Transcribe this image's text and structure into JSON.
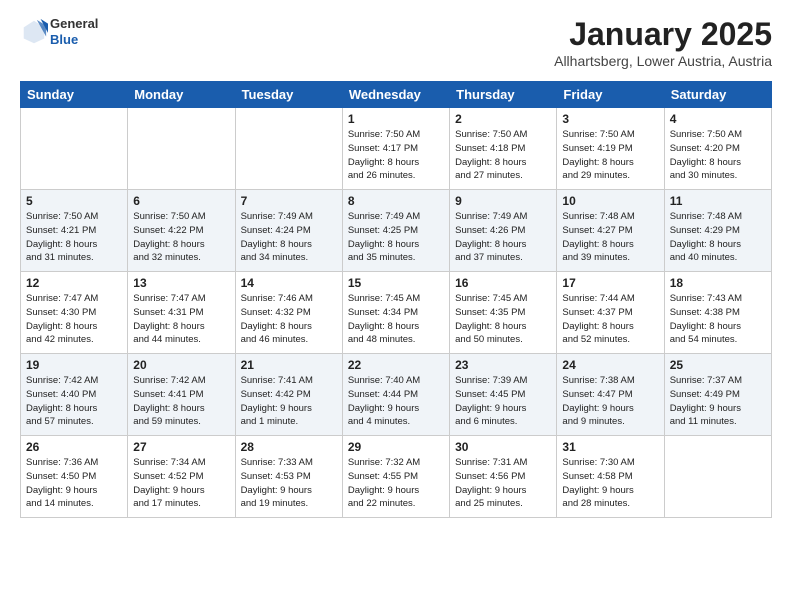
{
  "logo": {
    "general": "General",
    "blue": "Blue"
  },
  "header": {
    "title": "January 2025",
    "subtitle": "Allhartsberg, Lower Austria, Austria"
  },
  "weekdays": [
    "Sunday",
    "Monday",
    "Tuesday",
    "Wednesday",
    "Thursday",
    "Friday",
    "Saturday"
  ],
  "weeks": [
    [
      {
        "day": "",
        "info": ""
      },
      {
        "day": "",
        "info": ""
      },
      {
        "day": "",
        "info": ""
      },
      {
        "day": "1",
        "info": "Sunrise: 7:50 AM\nSunset: 4:17 PM\nDaylight: 8 hours\nand 26 minutes."
      },
      {
        "day": "2",
        "info": "Sunrise: 7:50 AM\nSunset: 4:18 PM\nDaylight: 8 hours\nand 27 minutes."
      },
      {
        "day": "3",
        "info": "Sunrise: 7:50 AM\nSunset: 4:19 PM\nDaylight: 8 hours\nand 29 minutes."
      },
      {
        "day": "4",
        "info": "Sunrise: 7:50 AM\nSunset: 4:20 PM\nDaylight: 8 hours\nand 30 minutes."
      }
    ],
    [
      {
        "day": "5",
        "info": "Sunrise: 7:50 AM\nSunset: 4:21 PM\nDaylight: 8 hours\nand 31 minutes."
      },
      {
        "day": "6",
        "info": "Sunrise: 7:50 AM\nSunset: 4:22 PM\nDaylight: 8 hours\nand 32 minutes."
      },
      {
        "day": "7",
        "info": "Sunrise: 7:49 AM\nSunset: 4:24 PM\nDaylight: 8 hours\nand 34 minutes."
      },
      {
        "day": "8",
        "info": "Sunrise: 7:49 AM\nSunset: 4:25 PM\nDaylight: 8 hours\nand 35 minutes."
      },
      {
        "day": "9",
        "info": "Sunrise: 7:49 AM\nSunset: 4:26 PM\nDaylight: 8 hours\nand 37 minutes."
      },
      {
        "day": "10",
        "info": "Sunrise: 7:48 AM\nSunset: 4:27 PM\nDaylight: 8 hours\nand 39 minutes."
      },
      {
        "day": "11",
        "info": "Sunrise: 7:48 AM\nSunset: 4:29 PM\nDaylight: 8 hours\nand 40 minutes."
      }
    ],
    [
      {
        "day": "12",
        "info": "Sunrise: 7:47 AM\nSunset: 4:30 PM\nDaylight: 8 hours\nand 42 minutes."
      },
      {
        "day": "13",
        "info": "Sunrise: 7:47 AM\nSunset: 4:31 PM\nDaylight: 8 hours\nand 44 minutes."
      },
      {
        "day": "14",
        "info": "Sunrise: 7:46 AM\nSunset: 4:32 PM\nDaylight: 8 hours\nand 46 minutes."
      },
      {
        "day": "15",
        "info": "Sunrise: 7:45 AM\nSunset: 4:34 PM\nDaylight: 8 hours\nand 48 minutes."
      },
      {
        "day": "16",
        "info": "Sunrise: 7:45 AM\nSunset: 4:35 PM\nDaylight: 8 hours\nand 50 minutes."
      },
      {
        "day": "17",
        "info": "Sunrise: 7:44 AM\nSunset: 4:37 PM\nDaylight: 8 hours\nand 52 minutes."
      },
      {
        "day": "18",
        "info": "Sunrise: 7:43 AM\nSunset: 4:38 PM\nDaylight: 8 hours\nand 54 minutes."
      }
    ],
    [
      {
        "day": "19",
        "info": "Sunrise: 7:42 AM\nSunset: 4:40 PM\nDaylight: 8 hours\nand 57 minutes."
      },
      {
        "day": "20",
        "info": "Sunrise: 7:42 AM\nSunset: 4:41 PM\nDaylight: 8 hours\nand 59 minutes."
      },
      {
        "day": "21",
        "info": "Sunrise: 7:41 AM\nSunset: 4:42 PM\nDaylight: 9 hours\nand 1 minute."
      },
      {
        "day": "22",
        "info": "Sunrise: 7:40 AM\nSunset: 4:44 PM\nDaylight: 9 hours\nand 4 minutes."
      },
      {
        "day": "23",
        "info": "Sunrise: 7:39 AM\nSunset: 4:45 PM\nDaylight: 9 hours\nand 6 minutes."
      },
      {
        "day": "24",
        "info": "Sunrise: 7:38 AM\nSunset: 4:47 PM\nDaylight: 9 hours\nand 9 minutes."
      },
      {
        "day": "25",
        "info": "Sunrise: 7:37 AM\nSunset: 4:49 PM\nDaylight: 9 hours\nand 11 minutes."
      }
    ],
    [
      {
        "day": "26",
        "info": "Sunrise: 7:36 AM\nSunset: 4:50 PM\nDaylight: 9 hours\nand 14 minutes."
      },
      {
        "day": "27",
        "info": "Sunrise: 7:34 AM\nSunset: 4:52 PM\nDaylight: 9 hours\nand 17 minutes."
      },
      {
        "day": "28",
        "info": "Sunrise: 7:33 AM\nSunset: 4:53 PM\nDaylight: 9 hours\nand 19 minutes."
      },
      {
        "day": "29",
        "info": "Sunrise: 7:32 AM\nSunset: 4:55 PM\nDaylight: 9 hours\nand 22 minutes."
      },
      {
        "day": "30",
        "info": "Sunrise: 7:31 AM\nSunset: 4:56 PM\nDaylight: 9 hours\nand 25 minutes."
      },
      {
        "day": "31",
        "info": "Sunrise: 7:30 AM\nSunset: 4:58 PM\nDaylight: 9 hours\nand 28 minutes."
      },
      {
        "day": "",
        "info": ""
      }
    ]
  ]
}
